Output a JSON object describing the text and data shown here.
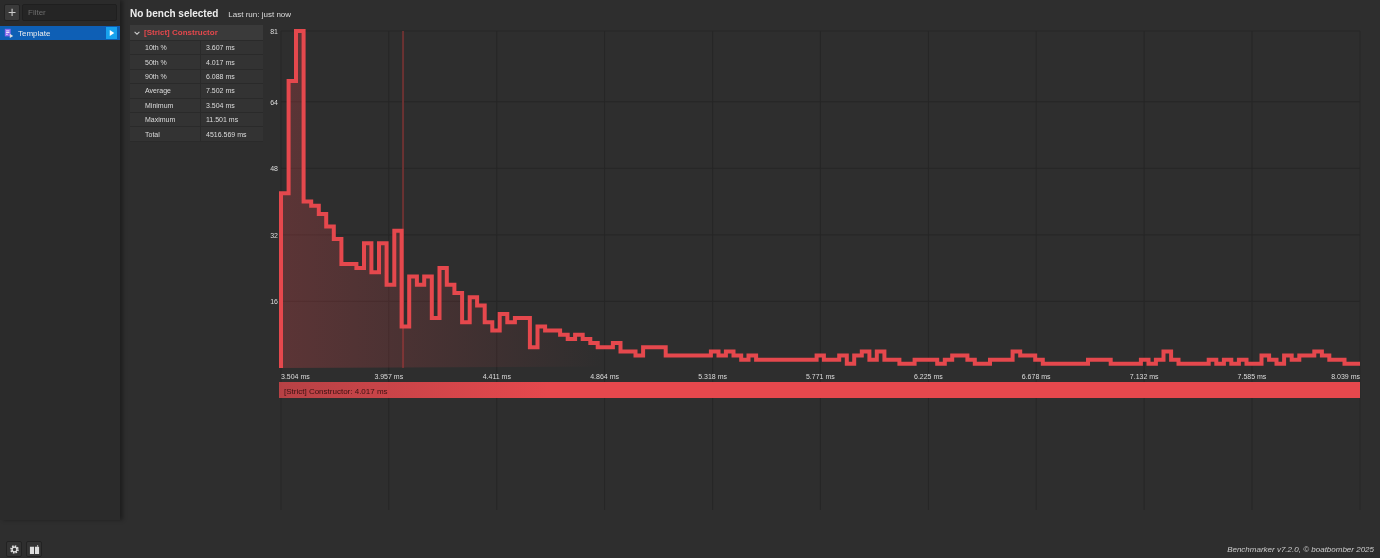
{
  "sidebar": {
    "add_button": "+",
    "filter": {
      "placeholder": "Filter"
    },
    "items": [
      {
        "label": "Template",
        "selected": true
      }
    ]
  },
  "header": {
    "title": "No bench selected",
    "last_run": "Last run: just now"
  },
  "stats": {
    "title": "[Strict] Constructor",
    "expanded": true,
    "rows": [
      {
        "label": "10th %",
        "value": "3.607 ms"
      },
      {
        "label": "50th %",
        "value": "4.017 ms"
      },
      {
        "label": "90th %",
        "value": "6.088 ms"
      },
      {
        "label": "Average",
        "value": "7.502 ms"
      },
      {
        "label": "Minimum",
        "value": "3.504 ms"
      },
      {
        "label": "Maximum",
        "value": "11.501 ms"
      },
      {
        "label": "Total",
        "value": "4516.569 ms"
      }
    ]
  },
  "chart_data": {
    "type": "area",
    "grid": true,
    "xlim": [
      3.504,
      8.039
    ],
    "ylim": [
      0,
      81
    ],
    "xticks": [
      {
        "value": 3.504,
        "label": "3.504 ms"
      },
      {
        "value": 3.957,
        "label": "3.957 ms"
      },
      {
        "value": 4.411,
        "label": "4.411 ms"
      },
      {
        "value": 4.864,
        "label": "4.864 ms"
      },
      {
        "value": 5.318,
        "label": "5.318 ms"
      },
      {
        "value": 5.771,
        "label": "5.771 ms"
      },
      {
        "value": 6.225,
        "label": "6.225 ms"
      },
      {
        "value": 6.678,
        "label": "6.678 ms"
      },
      {
        "value": 7.132,
        "label": "7.132 ms"
      },
      {
        "value": 7.585,
        "label": "7.585 ms"
      },
      {
        "value": 8.039,
        "label": "8.039 ms"
      }
    ],
    "yticks": [
      16,
      32,
      48,
      64,
      81
    ],
    "x": [
      3.504,
      3.536,
      3.567,
      3.599,
      3.631,
      3.663,
      3.694,
      3.726,
      3.758,
      3.789,
      3.821,
      3.853,
      3.884,
      3.916,
      3.948,
      3.98,
      4.011,
      4.043,
      4.075,
      4.106,
      4.138,
      4.17,
      4.201,
      4.233,
      4.265,
      4.297,
      4.328,
      4.36,
      4.392,
      4.423,
      4.455,
      4.487,
      4.518,
      4.55,
      4.582,
      4.614,
      4.645,
      4.677,
      4.709,
      4.74,
      4.772,
      4.804,
      4.835,
      4.867,
      4.899,
      4.931,
      4.962,
      4.994,
      5.026,
      5.057,
      5.089,
      5.121,
      5.152,
      5.184,
      5.216,
      5.248,
      5.279,
      5.311,
      5.343,
      5.374,
      5.406,
      5.438,
      5.469,
      5.501,
      5.533,
      5.565,
      5.596,
      5.628,
      5.66,
      5.691,
      5.723,
      5.755,
      5.786,
      5.818,
      5.85,
      5.882,
      5.913,
      5.945,
      5.977,
      6.008,
      6.04,
      6.072,
      6.103,
      6.135,
      6.167,
      6.199,
      6.23,
      6.262,
      6.294,
      6.325,
      6.357,
      6.389,
      6.42,
      6.452,
      6.484,
      6.516,
      6.547,
      6.579,
      6.611,
      6.642,
      6.674,
      6.706,
      6.737,
      6.769,
      6.801,
      6.833,
      6.864,
      6.896,
      6.928,
      6.959,
      6.991,
      7.023,
      7.054,
      7.086,
      7.118,
      7.15,
      7.181,
      7.213,
      7.245,
      7.276,
      7.308,
      7.34,
      7.371,
      7.403,
      7.435,
      7.467,
      7.498,
      7.53,
      7.562,
      7.593,
      7.625,
      7.657,
      7.688,
      7.72,
      7.752,
      7.784,
      7.815,
      7.847,
      7.879,
      7.91,
      7.942,
      7.974,
      8.039
    ],
    "series": [
      {
        "name": "[Strict] Constructor",
        "color": "#e5484d",
        "values": [
          42,
          69,
          81,
          40,
          39,
          37,
          34,
          31,
          25,
          25,
          24,
          30,
          23,
          30,
          20,
          33,
          10,
          22,
          20,
          22,
          12,
          24,
          20,
          18,
          11,
          17,
          15,
          11,
          9,
          13,
          11,
          12,
          12,
          5,
          10,
          9,
          9,
          8,
          7,
          8,
          7,
          6,
          5,
          5,
          6,
          4,
          4,
          3,
          5,
          5,
          5,
          3,
          3,
          3,
          3,
          3,
          3,
          4,
          3,
          4,
          3,
          2,
          3,
          2,
          2,
          2,
          2,
          2,
          2,
          2,
          2,
          3,
          2,
          2,
          3,
          1,
          3,
          4,
          2,
          4,
          2,
          2,
          1,
          1,
          2,
          2,
          2,
          1,
          2,
          3,
          3,
          2,
          1,
          1,
          2,
          2,
          2,
          4,
          3,
          3,
          2,
          1,
          1,
          1,
          1,
          1,
          1,
          2,
          2,
          2,
          1,
          1,
          1,
          1,
          2,
          1,
          2,
          4,
          2,
          1,
          1,
          1,
          1,
          2,
          1,
          2,
          1,
          2,
          1,
          1,
          3,
          2,
          1,
          3,
          2,
          3,
          3,
          4,
          3,
          2,
          2,
          1,
          1
        ]
      }
    ],
    "ref_lines": [
      {
        "axis": "x",
        "value": 4.017
      }
    ]
  },
  "legend": {
    "value": ": 4.017 ms"
  },
  "footer": {
    "credit": "Benchmarker v7.2.0, © boatbomber 2025"
  }
}
